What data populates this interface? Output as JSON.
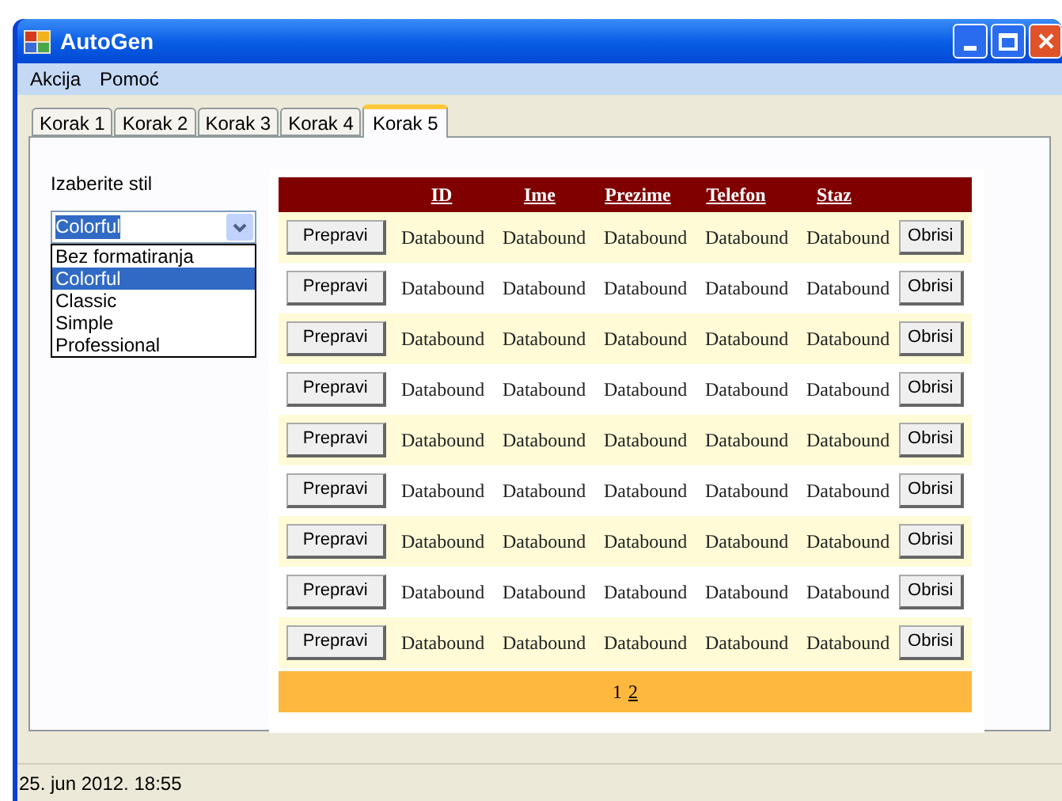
{
  "window": {
    "title": "AutoGen"
  },
  "menu": [
    "Akcija",
    "Pomoć"
  ],
  "tabs": [
    {
      "label": "Korak 1",
      "selected": false
    },
    {
      "label": "Korak 2",
      "selected": false
    },
    {
      "label": "Korak 3",
      "selected": false
    },
    {
      "label": "Korak 4",
      "selected": false
    },
    {
      "label": "Korak 5",
      "selected": true
    }
  ],
  "style_label": "Izaberite stil",
  "style_combo": {
    "value": "Colorful",
    "options": [
      {
        "label": "Bez formatiranja",
        "selected": false
      },
      {
        "label": "Colorful",
        "selected": true
      },
      {
        "label": "Classic",
        "selected": false
      },
      {
        "label": "Simple",
        "selected": false
      },
      {
        "label": "Professional",
        "selected": false
      }
    ]
  },
  "grid": {
    "columns": [
      "ID",
      "Ime",
      "Prezime",
      "Telefon",
      "Staz"
    ],
    "rows": [
      {
        "edit": "Prepravi",
        "cells": [
          "Databound",
          "Databound",
          "Databound",
          "Databound",
          "Databound"
        ],
        "delete": "Obrisi"
      },
      {
        "edit": "Prepravi",
        "cells": [
          "Databound",
          "Databound",
          "Databound",
          "Databound",
          "Databound"
        ],
        "delete": "Obrisi"
      },
      {
        "edit": "Prepravi",
        "cells": [
          "Databound",
          "Databound",
          "Databound",
          "Databound",
          "Databound"
        ],
        "delete": "Obrisi"
      },
      {
        "edit": "Prepravi",
        "cells": [
          "Databound",
          "Databound",
          "Databound",
          "Databound",
          "Databound"
        ],
        "delete": "Obrisi"
      },
      {
        "edit": "Prepravi",
        "cells": [
          "Databound",
          "Databound",
          "Databound",
          "Databound",
          "Databound"
        ],
        "delete": "Obrisi"
      },
      {
        "edit": "Prepravi",
        "cells": [
          "Databound",
          "Databound",
          "Databound",
          "Databound",
          "Databound"
        ],
        "delete": "Obrisi"
      },
      {
        "edit": "Prepravi",
        "cells": [
          "Databound",
          "Databound",
          "Databound",
          "Databound",
          "Databound"
        ],
        "delete": "Obrisi"
      },
      {
        "edit": "Prepravi",
        "cells": [
          "Databound",
          "Databound",
          "Databound",
          "Databound",
          "Databound"
        ],
        "delete": "Obrisi"
      },
      {
        "edit": "Prepravi",
        "cells": [
          "Databound",
          "Databound",
          "Databound",
          "Databound",
          "Databound"
        ],
        "delete": "Obrisi"
      }
    ],
    "pages": [
      {
        "label": "1",
        "selected": true
      },
      {
        "label": "2",
        "selected": false
      }
    ]
  },
  "status_bar": "25. jun 2012. 18:55"
}
